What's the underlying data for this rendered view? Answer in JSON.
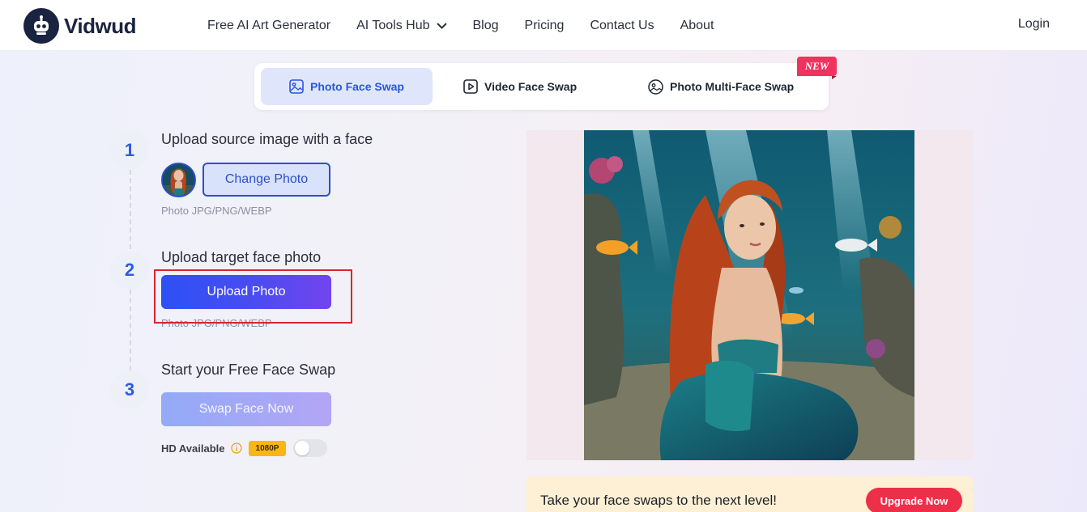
{
  "brand": {
    "name": "Vidwud",
    "icon": "robot-logo-icon"
  },
  "nav": {
    "items": [
      {
        "label": "Free AI Art Generator"
      },
      {
        "label": "AI Tools Hub",
        "icon": "chevron-down-icon"
      },
      {
        "label": "Blog"
      },
      {
        "label": "Pricing"
      },
      {
        "label": "Contact Us"
      },
      {
        "label": "About"
      }
    ],
    "login": "Login"
  },
  "tabs": [
    {
      "label": "Photo Face Swap",
      "icon": "image-icon",
      "active": true
    },
    {
      "label": "Video Face Swap",
      "icon": "video-icon",
      "active": false
    },
    {
      "label": "Photo Multi-Face Swap",
      "icon": "multi-face-icon",
      "active": false
    }
  ],
  "new_badge": "NEW",
  "steps": [
    {
      "number": "1",
      "title": "Upload source image with a face",
      "button": "Change Photo",
      "hint": "Photo JPG/PNG/WEBP"
    },
    {
      "number": "2",
      "title": "Upload target face photo",
      "button": "Upload Photo",
      "hint": "Photo JPG/PNG/WEBP"
    },
    {
      "number": "3",
      "title": "Start your Free Face Swap",
      "button": "Swap Face Now"
    }
  ],
  "hd": {
    "label": "HD Available",
    "resolution": "1080P",
    "enabled": false
  },
  "upgrade": {
    "text": "Take your face swaps to the next level!",
    "button": "Upgrade Now"
  },
  "colors": {
    "accent": "#2b5be3",
    "upgrade_button": "#ee2f4a",
    "new_badge": "#f1315e",
    "resolution_badge": "#f8b617",
    "highlight_box": "#d7262c"
  }
}
